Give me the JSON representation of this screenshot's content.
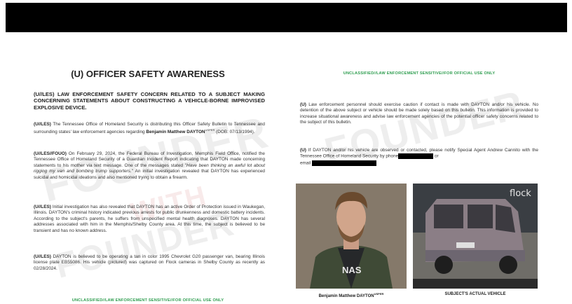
{
  "left": {
    "title": "(U) OFFICER SAFETY AWARENESS",
    "heading": "(U//LES) LAW ENFORCEMENT SAFETY CONCERN RELATED TO A SUBJECT MAKING CONCERNING STATEMENTS ABOUT CONSTRUCTING A VEHICLE-BORNE IMPROVISED EXPLOSIVE DEVICE.",
    "p1_a": "(U//LES)",
    "p1_b": " The Tennessee Office of Homeland Security is distributing this Officer Safety Bulletin to Tennessee and surrounding states' law enforcement agencies regarding ",
    "p1_name": "Benjamin Matthew DAYTON",
    "p1_sup": "USPER",
    "p1_c": " (DOB: 07/13/1994).",
    "p2_a": "(U//LES//FOUO)",
    "p2_b": " On February 29, 2024, the Federal Bureau of Investigation, Memphis Field Office, notified the Tennessee Office of Homeland Security of a Guardian Incident Report indicating that DAYTON made concerning statements to his mother via text message. One of the messages stated ",
    "p2_quote": "\"Have been thinking an awful lot about rigging my van and bombing trump supporters.\"",
    "p2_c": " An initial investigation revealed that DAYTON has experienced suicidal and homicidal ideations and also mentioned trying to obtain a firearm.",
    "p3_a": "(U//LES)",
    "p3_b": " Initial investigation has also revealed that DAYTON has an active Order of Protection issued in Waukegan, Illinois. DAYTON's criminal history indicated previous arrests for public drunkenness and domestic battery incidents. According to the subject's parents, he suffers from unspecified mental health diagnoses. DAYTON has several addresses associated with him in the Memphis/Shelby County area. At this time, the subject is believed to be transient and has no known address.",
    "p4_a": "(U//LES)",
    "p4_b": " DAYTON is believed to be operating a tan in color 1995 Chevrolet G20 passenger van, bearing Illinois license plate EB55086. His vehicle (pictured) was captured on Flock cameras in Shelby County as recently as 02/28/2024.",
    "footer_banner": "UNCLASSIFIED//LAW ENFORCEMENT SENSITIVE//FOR OFFICIAL USE ONLY"
  },
  "right": {
    "header_banner": "UNCLASSIFIED//LAW ENFORCEMENT SENSITIVE//FOR OFFICIAL USE ONLY",
    "p1_a": "(U)",
    "p1_b": " Law enforcement personnel should exercise caution if contact is made with DAYTON and/or his vehicle. No detention of the above subject or vehicle should be made solely based on this bulletin. This information is provided to increase situational awareness and advise law enforcement agencies of the potential officer safety concerns related to the subject of this bulletin.",
    "p2_a": "(U)",
    "p2_b": " If DAYTON and/or his vehicle are observed or contacted, please notify Special Agent Andrew Cannito with the Tennessee Office of Homeland Security by phone",
    "p2_or": " or",
    "p2_email": "email",
    "caption_suspect": "Benjamin Matthew DAYTON",
    "caption_suspect_sup": "USPER",
    "caption_vehicle": "SUBJECT'S ACTUAL VEHICLE",
    "flock_label": "flock",
    "shirt_text": "NAS"
  },
  "watermarks": [
    "FOUNDER",
    "WITH",
    "FOUNDER"
  ]
}
